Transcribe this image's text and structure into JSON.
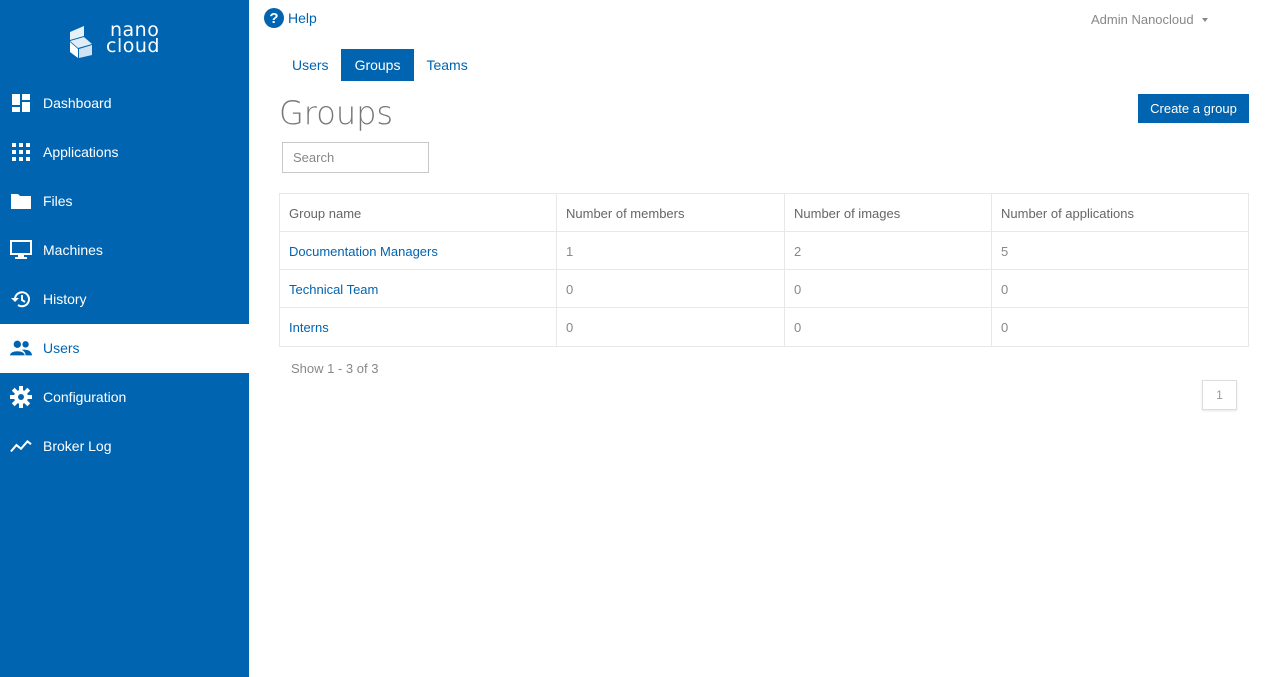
{
  "brand": {
    "line1": "nano",
    "line2": "cloud"
  },
  "sidebar": {
    "items": [
      {
        "label": "Dashboard",
        "icon": "dashboard-icon"
      },
      {
        "label": "Applications",
        "icon": "apps-grid-icon"
      },
      {
        "label": "Files",
        "icon": "folder-icon"
      },
      {
        "label": "Machines",
        "icon": "monitor-icon"
      },
      {
        "label": "History",
        "icon": "history-icon"
      },
      {
        "label": "Users",
        "icon": "users-icon",
        "active": true
      },
      {
        "label": "Configuration",
        "icon": "gear-icon"
      },
      {
        "label": "Broker Log",
        "icon": "trend-line-icon"
      }
    ]
  },
  "topbar": {
    "help_label": "Help",
    "user_label": "Admin Nanocloud"
  },
  "tabs": [
    {
      "label": "Users"
    },
    {
      "label": "Groups",
      "active": true
    },
    {
      "label": "Teams"
    }
  ],
  "page": {
    "title": "Groups",
    "create_label": "Create a group",
    "search_placeholder": "Search"
  },
  "table": {
    "headers": [
      "Group name",
      "Number of members",
      "Number of images",
      "Number of applications"
    ],
    "rows": [
      [
        "Documentation Managers",
        "1",
        "2",
        "5"
      ],
      [
        "Technical Team",
        "0",
        "0",
        "0"
      ],
      [
        "Interns",
        "0",
        "0",
        "0"
      ]
    ]
  },
  "footer": {
    "show_count": "Show 1 - 3 of 3",
    "page_number": "1"
  },
  "colors": {
    "primary": "#0064b0",
    "muted_text": "#888888"
  }
}
